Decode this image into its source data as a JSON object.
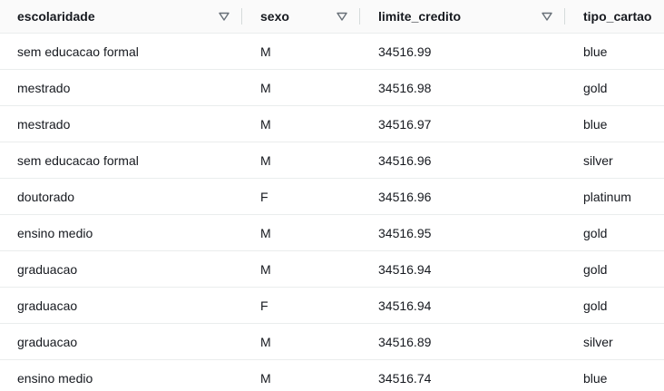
{
  "table": {
    "columns": [
      {
        "label": "escolaridade"
      },
      {
        "label": "sexo"
      },
      {
        "label": "limite_credito"
      },
      {
        "label": "tipo_cartao"
      }
    ],
    "sort_icon": "caret-down-outline-icon",
    "rows": [
      {
        "escolaridade": "sem educacao formal",
        "sexo": "M",
        "limite_credito": "34516.99",
        "tipo_cartao": "blue"
      },
      {
        "escolaridade": "mestrado",
        "sexo": "M",
        "limite_credito": "34516.98",
        "tipo_cartao": "gold"
      },
      {
        "escolaridade": "mestrado",
        "sexo": "M",
        "limite_credito": "34516.97",
        "tipo_cartao": "blue"
      },
      {
        "escolaridade": "sem educacao formal",
        "sexo": "M",
        "limite_credito": "34516.96",
        "tipo_cartao": "silver"
      },
      {
        "escolaridade": "doutorado",
        "sexo": "F",
        "limite_credito": "34516.96",
        "tipo_cartao": "platinum"
      },
      {
        "escolaridade": "ensino medio",
        "sexo": "M",
        "limite_credito": "34516.95",
        "tipo_cartao": "gold"
      },
      {
        "escolaridade": "graduacao",
        "sexo": "M",
        "limite_credito": "34516.94",
        "tipo_cartao": "gold"
      },
      {
        "escolaridade": "graduacao",
        "sexo": "F",
        "limite_credito": "34516.94",
        "tipo_cartao": "gold"
      },
      {
        "escolaridade": "graduacao",
        "sexo": "M",
        "limite_credito": "34516.89",
        "tipo_cartao": "silver"
      },
      {
        "escolaridade": "ensino medio",
        "sexo": "M",
        "limite_credito": "34516.74",
        "tipo_cartao": "blue"
      }
    ]
  }
}
